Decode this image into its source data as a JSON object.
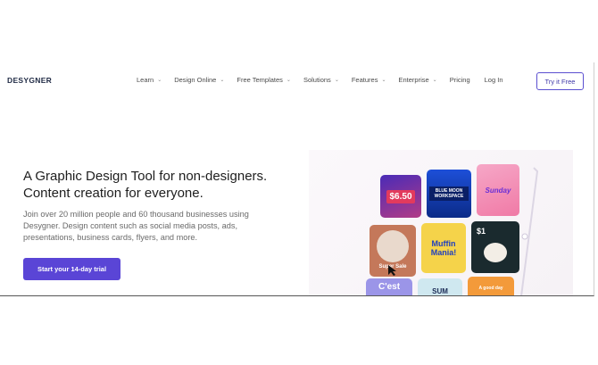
{
  "brand": {
    "logo": "DESYGNER"
  },
  "nav": {
    "dropdowns": [
      {
        "label": "Learn"
      },
      {
        "label": "Design Online"
      },
      {
        "label": "Free Templates"
      },
      {
        "label": "Solutions"
      },
      {
        "label": "Features"
      },
      {
        "label": "Enterprise"
      }
    ],
    "pricing": "Pricing",
    "login": "Log In",
    "try_free": "Try it Free"
  },
  "hero": {
    "title_line1": "A Graphic Design Tool for non-designers.",
    "title_line2": "Content creation for everyone.",
    "subtitle": "Join over 20 million people and 60 thousand businesses using Desygner. Design content such as social media posts, ads, presentations, business cards, flyers, and more.",
    "cta": "Start your 14-day trial"
  },
  "showcase": {
    "price_card": "$6.50",
    "workspace_card": "BLUE MOON WORKSPACE",
    "sunday_card": "Sunday",
    "muffin_card": "Muffin Mania!",
    "price2_card": "$1",
    "super_sale_card": "Super Sale",
    "cest_card": "C'est",
    "sum_card": "SUM",
    "good_day_card": "A good day"
  },
  "colors": {
    "accent": "#5a45d6",
    "logo": "#1f2a44"
  }
}
